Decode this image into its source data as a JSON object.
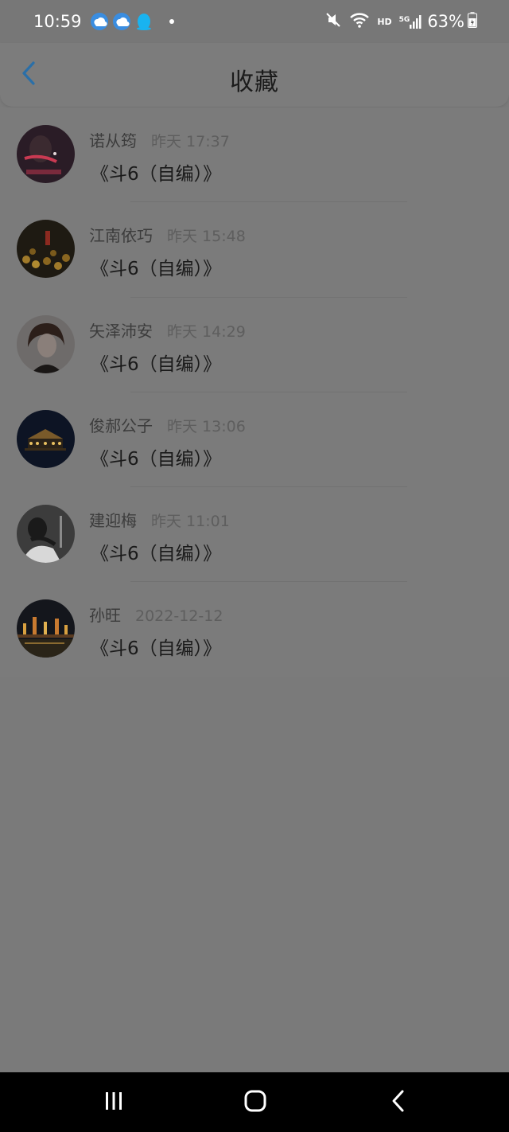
{
  "status_bar": {
    "time": "10:59",
    "battery": "63%",
    "network_badge": "HD",
    "network_gen": "5G",
    "icons": [
      "cloud-icon",
      "cloud-icon",
      "qq-penguin-icon",
      "mute-icon",
      "wifi-icon",
      "signal-icon",
      "battery-charging-icon"
    ]
  },
  "header": {
    "title": "收藏",
    "back_icon": "chevron-left-icon",
    "accent_color": "#2a6fa8"
  },
  "favorites": [
    {
      "author": "诺从筠",
      "time": "昨天 17:37",
      "title": "《斗6（自编）》"
    },
    {
      "author": "江南依巧",
      "time": "昨天 15:48",
      "title": "《斗6（自编）》"
    },
    {
      "author": "矢泽沛安",
      "time": "昨天 14:29",
      "title": "《斗6（自编）》"
    },
    {
      "author": "俊郝公子",
      "time": "昨天 13:06",
      "title": "《斗6（自编）》"
    },
    {
      "author": "建迎梅",
      "time": "昨天 11:01",
      "title": "《斗6（自编）》"
    },
    {
      "author": "孙旺",
      "time": "2022-12-12",
      "title": "《斗6（自编）》"
    }
  ],
  "nav_bar": {
    "icons": [
      "recent-apps-icon",
      "home-icon",
      "back-icon"
    ]
  }
}
